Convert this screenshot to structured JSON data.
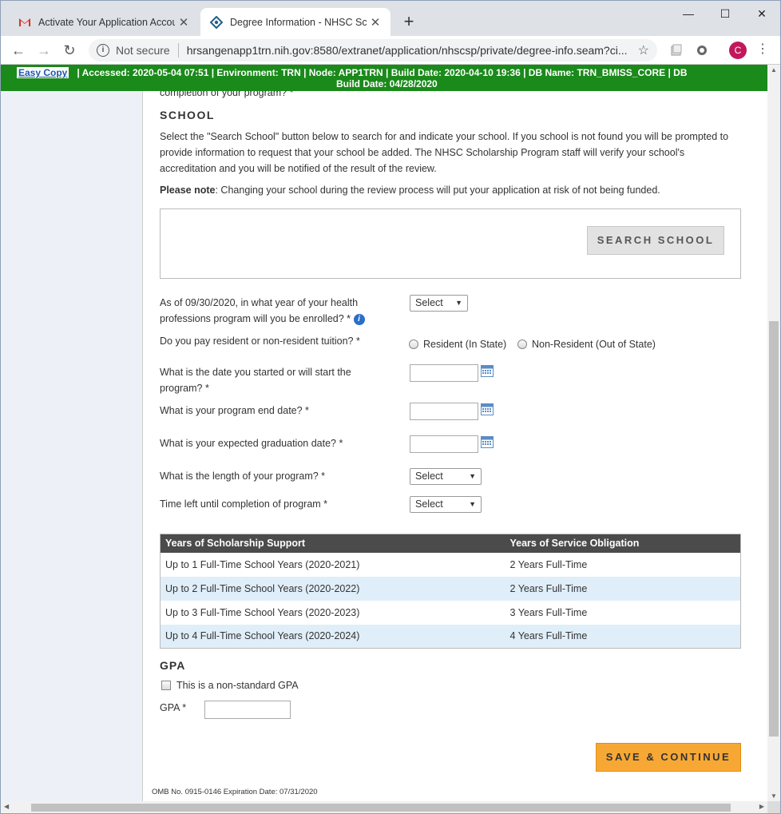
{
  "browser": {
    "tabs": [
      {
        "title": "Activate Your Application Account",
        "icon": "gmail-icon"
      },
      {
        "title": "Degree Information - NHSC Scholarship",
        "icon": "hrsa-icon"
      }
    ],
    "new_tab": "+",
    "url_security": "Not secure",
    "url": "hrsangenapp1trn.nih.gov:8580/extranet/application/nhscsp/private/degree-info.seam?ci...",
    "avatar_letter": "C"
  },
  "envbar": {
    "easy_copy": "Easy Copy",
    "line1": "|   Accessed: 2020-05-04 07:51   |   Environment: TRN   |   Node: APP1TRN   |   Build Date: 2020-04-10 19:36   |   DB Name: TRN_BMISS_CORE   |   DB",
    "line2": "Build Date: 04/28/2020"
  },
  "page": {
    "cut_text": "completion of your program? *",
    "school_heading": "SCHOOL",
    "school_instructions": "Select the \"Search School\" button below to search for and indicate your school. If you school is not found you will be prompted to provide information to request that your school be added. The NHSC Scholarship Program staff will verify your school's accreditation and you will be notified of the result of the review.",
    "note_bold": "Please note",
    "note_text": ": Changing your school during the review process will put your application at risk of not being funded.",
    "search_school_button": "SEARCH SCHOOL",
    "questions": {
      "year_enrolled": "As of 09/30/2020, in what year of your health professions program will you be enrolled? *",
      "tuition": "Do you pay resident or non-resident tuition? *",
      "start_date": "What is the date you started or will start the program? *",
      "end_date": "What is your program end date? *",
      "graduation_date": "What is your expected graduation date? *",
      "program_length": "What is the length of your program? *",
      "time_left": "Time left until completion of program *"
    },
    "select_default": "Select",
    "tuition_options": [
      "Resident (In State)",
      "Non-Resident (Out of State)"
    ],
    "info_icon": "i",
    "table": {
      "headers": [
        "Years of Scholarship Support",
        "Years of Service Obligation"
      ],
      "rows": [
        [
          "Up to 1 Full-Time School Years (2020-2021)",
          "2 Years Full-Time"
        ],
        [
          "Up to 2 Full-Time School Years (2020-2022)",
          "2 Years Full-Time"
        ],
        [
          "Up to 3 Full-Time School Years (2020-2023)",
          "3 Years Full-Time"
        ],
        [
          "Up to 4 Full-Time School Years (2020-2024)",
          "4 Years Full-Time"
        ]
      ]
    },
    "gpa_heading": "GPA",
    "nonstandard_gpa": "This is a non-standard GPA",
    "gpa_label": "GPA *",
    "save_button": "SAVE & CONTINUE",
    "omb": "OMB No. 0915-0146 Expiration Date: 07/31/2020"
  },
  "colors": {
    "envbar": "#1a8a1a",
    "save_button": "#f7a834",
    "table_header": "#4b4b4b",
    "table_alt_row": "#dfeef9"
  }
}
